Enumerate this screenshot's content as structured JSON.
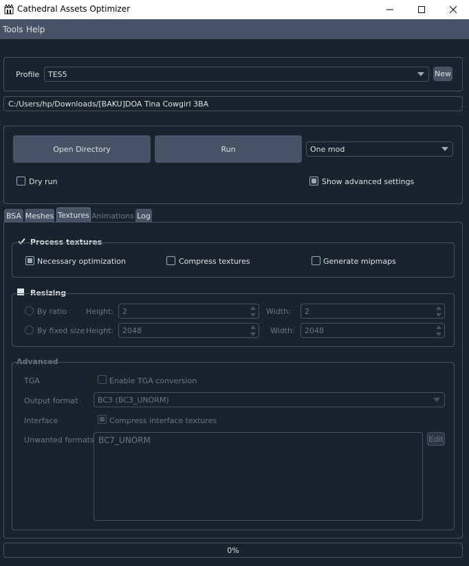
{
  "window": {
    "title": "Cathedral Assets Optimizer",
    "minimize_glyph": "─",
    "maximize_glyph": "☐",
    "close_glyph": "✕"
  },
  "menu": {
    "items": [
      "Tools",
      "Help"
    ]
  },
  "profile": {
    "label": "Profile",
    "value": "TES5",
    "new_button": "New"
  },
  "path": {
    "value": "C:/Users/hp/Downloads/[BAKU]DOA Tina Cowgirl 3BA"
  },
  "actions": {
    "open_directory": "Open Directory",
    "run": "Run",
    "mode": "One mod",
    "dry_run": "Dry run",
    "show_advanced": "Show advanced settings"
  },
  "tabs": {
    "bsa": "BSA",
    "meshes": "Meshes",
    "textures": "Textures",
    "animations": "Animations",
    "log": "Log"
  },
  "process_textures": {
    "title": "Process textures",
    "necessary_optimization": "Necessary optimization",
    "compress_textures": "Compress textures",
    "generate_mipmaps": "Generate mipmaps"
  },
  "resizing": {
    "title": "Resizing",
    "by_ratio": "By ratio",
    "by_fixed_size": "By fixed size",
    "height_label": "Height:",
    "width_label": "Width:",
    "ratio_height": "2",
    "ratio_width": "2",
    "fixed_height": "2048",
    "fixed_width": "2048"
  },
  "advanced": {
    "title": "Advanced",
    "tga_label": "TGA",
    "tga_checkbox": "Enable TGA conversion",
    "output_format_label": "Output format",
    "output_format_value": "BC3 (BC3_UNORM)",
    "interface_label": "Interface",
    "interface_checkbox": "Compress interface textures",
    "unwanted_label": "Unwanted formats",
    "unwanted_value": "BC7_UNORM",
    "edit_button": "Edit"
  },
  "progress": {
    "text": "0%",
    "value": 0
  },
  "colors": {
    "background": "#19232d",
    "panel": "#455364",
    "text": "#e0e1e3",
    "disabled_text": "#6b7681"
  }
}
